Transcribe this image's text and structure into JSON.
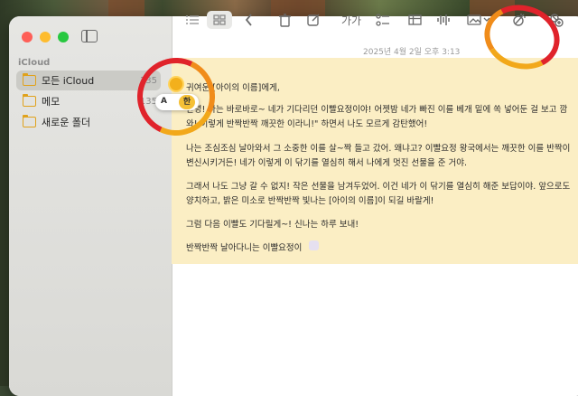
{
  "sidebar": {
    "section": "iCloud",
    "folders": [
      {
        "label": "모든 iCloud",
        "count": "135"
      },
      {
        "label": "메모",
        "count": "135"
      },
      {
        "label": "새로운 폴더",
        "count": ""
      }
    ]
  },
  "toolbar": {
    "font_label": "가가"
  },
  "ime": {
    "latin": "A",
    "korean": "한"
  },
  "note": {
    "date": "2025년 4월 2일 오후 3:13",
    "lines": [
      "귀여운 [아이의 이름]에게,",
      "안녕! 나는 바로바로~ 네가 기다리던 이빨요정이야! 어젯밤 네가 빠진 이를 베개 밑에 쏙 넣어둔 걸 보고 깜",
      "와! 이렇게 반짝반짝 깨끗한 이라니!\" 하면서 나도 모르게 감탄했어!",
      "나는 조심조심 날아와서 그 소중한 이를 살~짝 들고 갔어. 왜냐고? 이빨요정 왕국에서는 깨끗한 이를 반짝이",
      "변신시키거든! 네가 이렇게 이 닦기를 열심히 해서 나에게 멋진 선물을 준 거야.",
      "그래서 나도 그냥 갈 수 없지! 작은 선물을 남겨두었어. 이건 네가 이 닦기를 열심히 해준 보답이야. 앞으로도",
      "양치하고, 밝은 미소로 반짝반짝 빛나는 [아이의 이름]이 되길 바랄게!",
      "그럼 다음 이빨도 기다릴게~! 신나는 하루 보내!",
      "반짝반짝 날아다니는 이빨요정이"
    ]
  },
  "colors": {
    "highlight": "#fbeec4",
    "annotation_red": "#e0232b",
    "annotation_orange": "#f2a81a"
  }
}
